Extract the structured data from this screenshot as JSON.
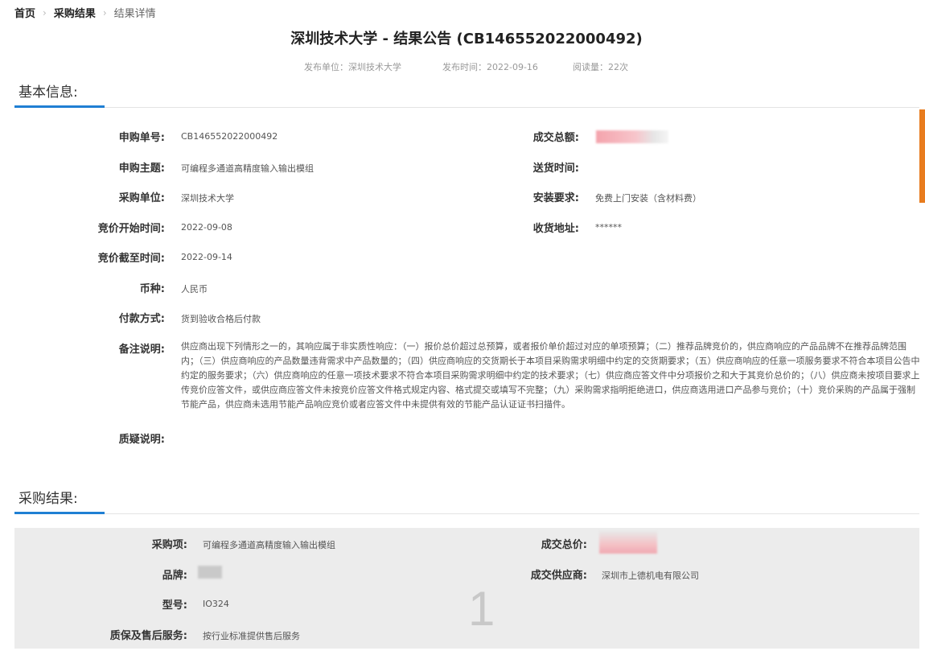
{
  "breadcrumb": {
    "home": "首页",
    "results": "采购结果",
    "current": "结果详情"
  },
  "page_title": "深圳技术大学 - 结果公告 (CB146552022000492)",
  "meta": {
    "publisher": "发布单位：深圳技术大学",
    "publish_time": "发布时间：2022-09-16",
    "views": "阅读量：22次"
  },
  "basic_section": {
    "heading": "基本信息:",
    "purchase_no_label": "申购单号:",
    "purchase_no": "CB146552022000492",
    "subject_label": "申购主题:",
    "subject": "可编程多通道高精度输入输出模组",
    "unit_label": "采购单位:",
    "unit": "深圳技术大学",
    "bid_start_label": "竞价开始时间:",
    "bid_start": "2022-09-08",
    "bid_end_label": "竞价截至时间:",
    "bid_end": "2022-09-14",
    "currency_label": "币种:",
    "currency": "人民币",
    "payment_label": "付款方式:",
    "payment": "货到验收合格后付款",
    "remark_label": "备注说明:",
    "remark": "供应商出现下列情形之一的，其响应属于非实质性响应：（一）报价总价超过总预算，或者报价单价超过对应的单项预算；（二）推荐品牌竞价的，供应商响应的产品品牌不在推荐品牌范围内；（三）供应商响应的产品数量违背需求中产品数量的；（四）供应商响应的交货期长于本项目采购需求明细中约定的交货期要求；（五）供应商响应的任意一项服务要求不符合本项目公告中约定的服务要求；（六）供应商响应的任意一项技术要求不符合本项目采购需求明细中约定的技术要求；（七）供应商应答文件中分项报价之和大于其竞价总价的；（八）供应商未按项目要求上传竞价应答文件，或供应商应答文件未按竞价应答文件格式规定内容、格式提交或填写不完整；（九）采购需求指明拒绝进口，供应商选用进口产品参与竞价；（十）竞价采购的产品属于强制节能产品，供应商未选用节能产品响应竞价或者应答文件中未提供有效的节能产品认证证书扫描件。",
    "query_label": "质疑说明:",
    "total_amount_label": "成交总额:",
    "delivery_time_label": "送货时间:",
    "install_label": "安装要求:",
    "install": "免费上门安装（含材料费）",
    "address_label": "收货地址:",
    "address": "******"
  },
  "result_section": {
    "heading": "采购结果:",
    "item_label": "采购项:",
    "item": "可编程多通道高精度输入输出模组",
    "brand_label": "品牌:",
    "model_label": "型号:",
    "model": "IO324",
    "warranty_label": "质保及售后服务:",
    "warranty": "按行业标准提供售后服务",
    "total_price_label": "成交总价:",
    "supplier_label": "成交供应商:",
    "supplier": "深圳市上德机电有限公司",
    "item_index": "1"
  },
  "colors": {
    "accent": "#1f7fd3",
    "side_tab": "#e87c1e",
    "panel_bg": "#ececec"
  }
}
